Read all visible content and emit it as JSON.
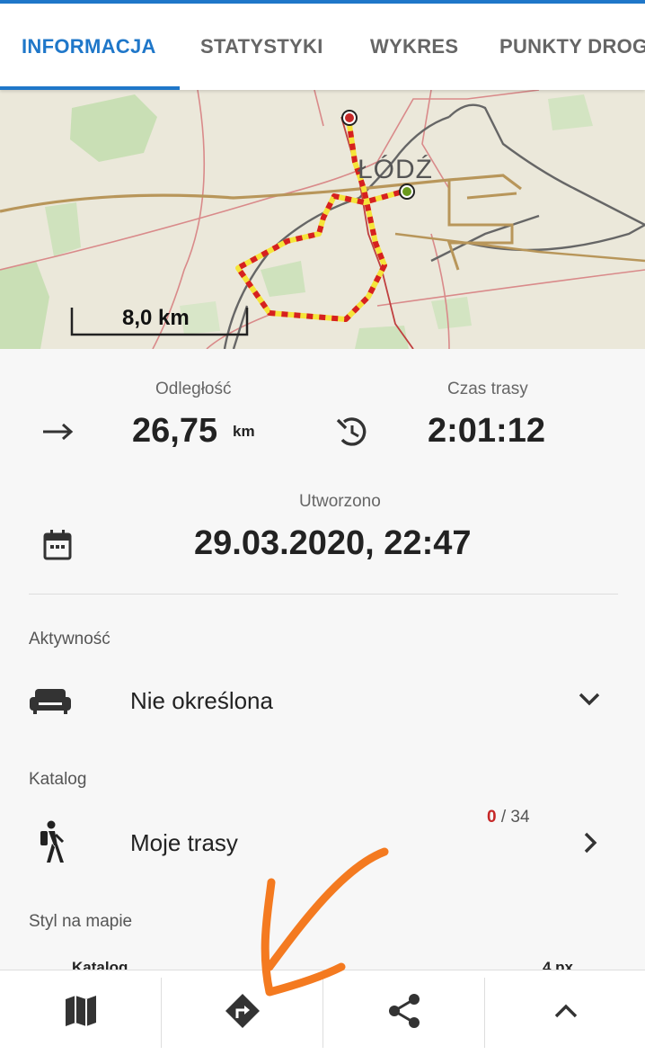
{
  "tabs": [
    {
      "label": "INFORMACJA"
    },
    {
      "label": "STATYSTYKI"
    },
    {
      "label": "WYKRES"
    },
    {
      "label": "PUNKTY DROG"
    }
  ],
  "map": {
    "city_label": "ŁÓDŹ",
    "scale_label": "8,0 km"
  },
  "stats": {
    "distance_label": "Odległość",
    "distance_value": "26,75",
    "distance_unit": "km",
    "time_label": "Czas trasy",
    "time_value": "2:01:12",
    "created_label": "Utworzono",
    "created_value": "29.03.2020, 22:47"
  },
  "activity": {
    "section_label": "Aktywność",
    "value": "Nie określona"
  },
  "catalog": {
    "section_label": "Katalog",
    "value": "Moje trasy",
    "counter_current": "0",
    "counter_rest": " / 34"
  },
  "style": {
    "section_label": "Styl na mapie",
    "peek_left": "Katalog",
    "peek_right": "4 px"
  },
  "icons": {
    "distance": "arrow-right-icon",
    "time": "timer-icon",
    "created": "calendar-icon",
    "activity": "sofa-icon",
    "catalog": "hiker-icon",
    "bottom": [
      "map-icon",
      "directions-icon",
      "share-icon",
      "chevron-up-icon"
    ]
  },
  "colors": {
    "accent": "#1f77c9",
    "route_red": "#d62020",
    "route_yellow": "#f5e43a",
    "annotation": "#f47a20"
  }
}
